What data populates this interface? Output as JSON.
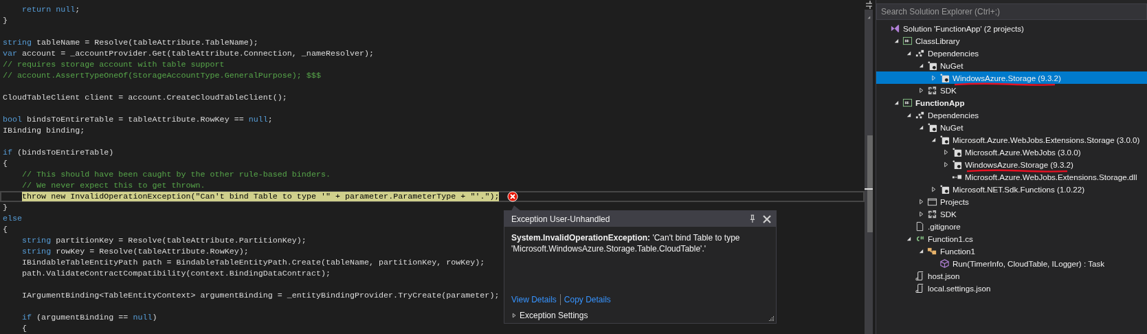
{
  "editor": {
    "lines": [
      {
        "kind": "code",
        "highlighted": false,
        "segments": [
          {
            "kind": "keyword",
            "text": "    return"
          },
          {
            "kind": "keyword",
            "text": " null"
          },
          {
            "kind": "plain",
            "text": ";"
          }
        ]
      },
      {
        "kind": "code",
        "highlighted": false,
        "segments": [
          {
            "kind": "plain",
            "text": "}"
          }
        ]
      },
      {
        "kind": "blank"
      },
      {
        "kind": "code",
        "highlighted": false,
        "segments": [
          {
            "kind": "keyword",
            "text": "string"
          },
          {
            "kind": "plain",
            "text": " tableName = Resolve(tableAttribute.TableName);"
          }
        ]
      },
      {
        "kind": "code",
        "highlighted": false,
        "segments": [
          {
            "kind": "keyword",
            "text": "var"
          },
          {
            "kind": "plain",
            "text": " account = _accountProvider.Get(tableAttribute.Connection, _nameResolver);"
          }
        ]
      },
      {
        "kind": "code",
        "highlighted": false,
        "segments": [
          {
            "kind": "comment",
            "text": "// requires storage account with table support"
          }
        ]
      },
      {
        "kind": "code",
        "highlighted": false,
        "segments": [
          {
            "kind": "comment",
            "text": "// account.AssertTypeOneOf(StorageAccountType.GeneralPurpose); $$$"
          }
        ]
      },
      {
        "kind": "blank"
      },
      {
        "kind": "code",
        "highlighted": false,
        "segments": [
          {
            "kind": "plain",
            "text": "CloudTableClient client = account.CreateCloudTableClient();"
          }
        ]
      },
      {
        "kind": "blank"
      },
      {
        "kind": "code",
        "highlighted": false,
        "segments": [
          {
            "kind": "keyword",
            "text": "bool"
          },
          {
            "kind": "plain",
            "text": " bindsToEntireTable = tableAttribute.RowKey == "
          },
          {
            "kind": "keyword",
            "text": "null"
          },
          {
            "kind": "plain",
            "text": ";"
          }
        ]
      },
      {
        "kind": "code",
        "highlighted": false,
        "segments": [
          {
            "kind": "plain",
            "text": "IBinding binding;"
          }
        ]
      },
      {
        "kind": "blank"
      },
      {
        "kind": "code",
        "highlighted": false,
        "segments": [
          {
            "kind": "keyword",
            "text": "if"
          },
          {
            "kind": "plain",
            "text": " (bindsToEntireTable)"
          }
        ]
      },
      {
        "kind": "code",
        "highlighted": false,
        "segments": [
          {
            "kind": "plain",
            "text": "{"
          }
        ]
      },
      {
        "kind": "code",
        "highlighted": false,
        "segments": [
          {
            "kind": "comment",
            "text": "    // This should have been caught by the other rule-based binders."
          }
        ]
      },
      {
        "kind": "code",
        "highlighted": false,
        "segments": [
          {
            "kind": "comment",
            "text": "    // We never expect this to get thrown."
          }
        ]
      },
      {
        "kind": "code",
        "highlighted": true,
        "segments": [
          {
            "kind": "keyword",
            "text": "    throw"
          },
          {
            "kind": "keyword",
            "text": " new"
          },
          {
            "kind": "plain",
            "text": " InvalidOperationException("
          },
          {
            "kind": "string",
            "text": "\"Can't bind Table to type '\""
          },
          {
            "kind": "plain",
            "text": " + parameter.ParameterType + "
          },
          {
            "kind": "string",
            "text": "\"'.\""
          },
          {
            "kind": "plain",
            "text": ");"
          }
        ]
      },
      {
        "kind": "code",
        "highlighted": false,
        "segments": [
          {
            "kind": "plain",
            "text": "}"
          }
        ]
      },
      {
        "kind": "code",
        "highlighted": false,
        "segments": [
          {
            "kind": "keyword",
            "text": "else"
          }
        ]
      },
      {
        "kind": "code",
        "highlighted": false,
        "segments": [
          {
            "kind": "plain",
            "text": "{"
          }
        ]
      },
      {
        "kind": "code",
        "highlighted": false,
        "segments": [
          {
            "kind": "keyword",
            "text": "    string"
          },
          {
            "kind": "plain",
            "text": " partitionKey = Resolve(tableAttribute.PartitionKey);"
          }
        ]
      },
      {
        "kind": "code",
        "highlighted": false,
        "segments": [
          {
            "kind": "keyword",
            "text": "    string"
          },
          {
            "kind": "plain",
            "text": " rowKey = Resolve(tableAttribute.RowKey);"
          }
        ]
      },
      {
        "kind": "code",
        "highlighted": false,
        "segments": [
          {
            "kind": "plain",
            "text": "    IBindableTableEntityPath path = BindableTableEntityPath.Create(tableName, partitionKey, rowKey);"
          }
        ]
      },
      {
        "kind": "code",
        "highlighted": false,
        "segments": [
          {
            "kind": "plain",
            "text": "    path.ValidateContractCompatibility(context.BindingDataContract);"
          }
        ]
      },
      {
        "kind": "blank"
      },
      {
        "kind": "code",
        "highlighted": false,
        "segments": [
          {
            "kind": "plain",
            "text": "    IArgumentBinding<TableEntityContext> argumentBinding = _entityBindingProvider.TryCreate(parameter);"
          }
        ]
      },
      {
        "kind": "blank"
      },
      {
        "kind": "code",
        "highlighted": false,
        "segments": [
          {
            "kind": "keyword",
            "text": "    if"
          },
          {
            "kind": "plain",
            "text": " (argumentBinding == "
          },
          {
            "kind": "keyword",
            "text": "null"
          },
          {
            "kind": "plain",
            "text": ")"
          }
        ]
      },
      {
        "kind": "code",
        "highlighted": false,
        "segments": [
          {
            "kind": "plain",
            "text": "    {"
          }
        ]
      }
    ]
  },
  "exception_popup": {
    "title": "Exception User-Unhandled",
    "message": "**System.InvalidOperationException:** 'Can't bind Table to type 'Microsoft.WindowsAzure.Storage.Table.CloudTable'.'",
    "links": [
      "View Details",
      "Copy Details"
    ],
    "settings": {
      "label": "Exception Settings",
      "expanded": false
    }
  },
  "solution_explorer": {
    "search": {
      "placeholder": "Search Solution Explorer (Ctrl+;)"
    },
    "tree": [
      {
        "label": "Solution 'FunctionApp' (2 projects)",
        "kind": "solution",
        "selected": false,
        "marked": false,
        "children": [
          {
            "label": "ClassLibrary",
            "kind": "csproj",
            "bold": false,
            "expanded": true,
            "selected": false,
            "marked": false,
            "children": [
              {
                "label": "Dependencies",
                "kind": "dependencies",
                "expanded": true,
                "selected": false,
                "marked": false,
                "children": [
                  {
                    "label": "NuGet",
                    "kind": "nuget",
                    "expanded": true,
                    "selected": false,
                    "marked": false,
                    "children": [
                      {
                        "label": "WindowsAzure.Storage (9.3.2)",
                        "kind": "package",
                        "expanded": false,
                        "selected": true,
                        "marked": true
                      }
                    ]
                  },
                  {
                    "label": "SDK",
                    "kind": "sdk",
                    "expanded": false,
                    "selected": false,
                    "marked": false
                  }
                ]
              }
            ]
          },
          {
            "label": "FunctionApp",
            "kind": "csproj",
            "bold": true,
            "expanded": true,
            "selected": false,
            "marked": false,
            "children": [
              {
                "label": "Dependencies",
                "kind": "dependencies",
                "expanded": true,
                "selected": false,
                "marked": false,
                "children": [
                  {
                    "label": "NuGet",
                    "kind": "nuget",
                    "expanded": true,
                    "selected": false,
                    "marked": false,
                    "children": [
                      {
                        "label": "Microsoft.Azure.WebJobs.Extensions.Storage (3.0.0)",
                        "kind": "package",
                        "expanded": true,
                        "selected": false,
                        "marked": false,
                        "children": [
                          {
                            "label": "Microsoft.Azure.WebJobs (3.0.0)",
                            "kind": "package",
                            "expanded": false,
                            "selected": false,
                            "marked": false
                          },
                          {
                            "label": "WindowsAzure.Storage (9.3.2)",
                            "kind": "package",
                            "expanded": false,
                            "selected": false,
                            "marked": true
                          },
                          {
                            "label": "Microsoft.Azure.WebJobs.Extensions.Storage.dll",
                            "kind": "dll",
                            "selected": false,
                            "marked": false
                          }
                        ]
                      },
                      {
                        "label": "Microsoft.NET.Sdk.Functions (1.0.22)",
                        "kind": "package",
                        "expanded": false,
                        "selected": false,
                        "marked": false
                      }
                    ]
                  },
                  {
                    "label": "Projects",
                    "kind": "projects",
                    "expanded": false,
                    "selected": false,
                    "marked": false
                  },
                  {
                    "label": "SDK",
                    "kind": "sdk",
                    "expanded": false,
                    "selected": false,
                    "marked": false
                  }
                ]
              },
              {
                "label": ".gitignore",
                "kind": "file",
                "selected": false,
                "marked": false
              },
              {
                "label": "Function1.cs",
                "kind": "csfile",
                "expanded": true,
                "selected": false,
                "marked": false,
                "children": [
                  {
                    "label": "Function1",
                    "kind": "class",
                    "expanded": true,
                    "selected": false,
                    "marked": false,
                    "children": [
                      {
                        "label": "Run(TimerInfo, CloudTable, ILogger) : Task",
                        "kind": "method",
                        "selected": false,
                        "marked": false
                      }
                    ]
                  }
                ]
              },
              {
                "label": "host.json",
                "kind": "json",
                "selected": false,
                "marked": false
              },
              {
                "label": "local.settings.json",
                "kind": "json",
                "selected": false,
                "marked": false
              }
            ]
          }
        ]
      }
    ]
  }
}
